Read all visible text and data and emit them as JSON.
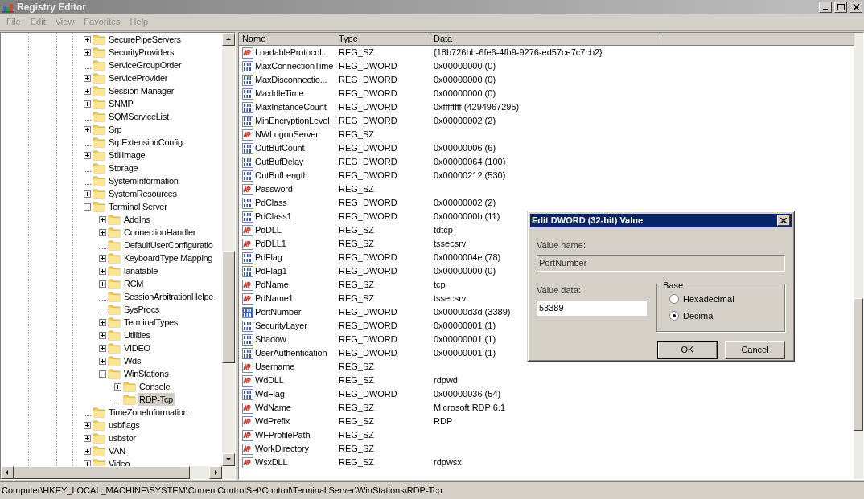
{
  "window": {
    "title": "Registry Editor"
  },
  "menu": [
    "File",
    "Edit",
    "View",
    "Favorites",
    "Help"
  ],
  "tree": [
    {
      "label": "SecurePipeServers",
      "kind": "collapsed",
      "selected": false
    },
    {
      "label": "SecurityProviders",
      "kind": "collapsed",
      "selected": false
    },
    {
      "label": "ServiceGroupOrder",
      "kind": "leaf",
      "selected": false
    },
    {
      "label": "ServiceProvider",
      "kind": "collapsed",
      "selected": false
    },
    {
      "label": "Session Manager",
      "kind": "collapsed",
      "selected": false
    },
    {
      "label": "SNMP",
      "kind": "collapsed",
      "selected": false
    },
    {
      "label": "SQMServiceList",
      "kind": "leaf",
      "selected": false
    },
    {
      "label": "Srp",
      "kind": "collapsed",
      "selected": false
    },
    {
      "label": "SrpExtensionConfig",
      "kind": "leaf",
      "selected": false
    },
    {
      "label": "StillImage",
      "kind": "collapsed",
      "selected": false
    },
    {
      "label": "Storage",
      "kind": "leaf",
      "selected": false
    },
    {
      "label": "SystemInformation",
      "kind": "leaf",
      "selected": false
    },
    {
      "label": "SystemResources",
      "kind": "collapsed",
      "selected": false
    },
    {
      "label": "Terminal Server",
      "kind": "expanded",
      "selected": false,
      "children": [
        {
          "label": "AddIns",
          "kind": "collapsed",
          "selected": false
        },
        {
          "label": "ConnectionHandler",
          "kind": "collapsed",
          "selected": false
        },
        {
          "label": "DefaultUserConfiguratio",
          "kind": "leaf",
          "selected": false
        },
        {
          "label": "KeyboardType Mapping",
          "kind": "collapsed",
          "selected": false
        },
        {
          "label": "lanatable",
          "kind": "collapsed",
          "selected": false
        },
        {
          "label": "RCM",
          "kind": "collapsed",
          "selected": false
        },
        {
          "label": "SessionArbitrationHelpe",
          "kind": "leaf",
          "selected": false
        },
        {
          "label": "SysProcs",
          "kind": "leaf",
          "selected": false
        },
        {
          "label": "TerminalTypes",
          "kind": "collapsed",
          "selected": false
        },
        {
          "label": "Utilities",
          "kind": "collapsed",
          "selected": false
        },
        {
          "label": "VIDEO",
          "kind": "collapsed",
          "selected": false
        },
        {
          "label": "Wds",
          "kind": "collapsed",
          "selected": false
        },
        {
          "label": "WinStations",
          "kind": "expanded",
          "selected": false,
          "children": [
            {
              "label": "Console",
              "kind": "collapsed",
              "selected": false
            },
            {
              "label": "RDP-Tcp",
              "kind": "leaf",
              "selected": true
            }
          ]
        }
      ]
    },
    {
      "label": "TimeZoneInformation",
      "kind": "leaf",
      "selected": false
    },
    {
      "label": "usbflags",
      "kind": "collapsed",
      "selected": false
    },
    {
      "label": "usbstor",
      "kind": "collapsed",
      "selected": false
    },
    {
      "label": "VAN",
      "kind": "collapsed",
      "selected": false
    },
    {
      "label": "Video",
      "kind": "collapsed",
      "selected": false
    }
  ],
  "table": {
    "columns": [
      "Name",
      "Type",
      "Data"
    ],
    "rows": [
      {
        "name": "LoadableProtocol...",
        "type": "REG_SZ",
        "data": "{18b726bb-6fe6-4fb9-9276-ed57ce7c7cb2}",
        "kind": "string",
        "selected": false
      },
      {
        "name": "MaxConnectionTime",
        "type": "REG_DWORD",
        "data": "0x00000000 (0)",
        "kind": "binary",
        "selected": false
      },
      {
        "name": "MaxDisconnectio...",
        "type": "REG_DWORD",
        "data": "0x00000000 (0)",
        "kind": "binary",
        "selected": false
      },
      {
        "name": "MaxIdleTime",
        "type": "REG_DWORD",
        "data": "0x00000000 (0)",
        "kind": "binary",
        "selected": false
      },
      {
        "name": "MaxInstanceCount",
        "type": "REG_DWORD",
        "data": "0xffffffff (4294967295)",
        "kind": "binary",
        "selected": false
      },
      {
        "name": "MinEncryptionLevel",
        "type": "REG_DWORD",
        "data": "0x00000002 (2)",
        "kind": "binary",
        "selected": false
      },
      {
        "name": "NWLogonServer",
        "type": "REG_SZ",
        "kind": "string",
        "selected": false
      },
      {
        "name": "OutBufCount",
        "type": "REG_DWORD",
        "data": "0x00000006 (6)",
        "kind": "binary",
        "selected": false
      },
      {
        "name": "OutBufDelay",
        "type": "REG_DWORD",
        "data": "0x00000064 (100)",
        "kind": "binary",
        "selected": false
      },
      {
        "name": "OutBufLength",
        "type": "REG_DWORD",
        "data": "0x00000212 (530)",
        "kind": "binary",
        "selected": false
      },
      {
        "name": "Password",
        "type": "REG_SZ",
        "kind": "string",
        "selected": false
      },
      {
        "name": "PdClass",
        "type": "REG_DWORD",
        "data": "0x00000002 (2)",
        "kind": "binary",
        "selected": false
      },
      {
        "name": "PdClass1",
        "type": "REG_DWORD",
        "data": "0x0000000b (11)",
        "kind": "binary",
        "selected": false
      },
      {
        "name": "PdDLL",
        "type": "REG_SZ",
        "data": "tdtcp",
        "kind": "string",
        "selected": false
      },
      {
        "name": "PdDLL1",
        "type": "REG_SZ",
        "data": "tssecsrv",
        "kind": "string",
        "selected": false
      },
      {
        "name": "PdFlag",
        "type": "REG_DWORD",
        "data": "0x0000004e (78)",
        "kind": "binary",
        "selected": false
      },
      {
        "name": "PdFlag1",
        "type": "REG_DWORD",
        "data": "0x00000000 (0)",
        "kind": "binary",
        "selected": false
      },
      {
        "name": "PdName",
        "type": "REG_SZ",
        "data": "tcp",
        "kind": "string",
        "selected": false
      },
      {
        "name": "PdName1",
        "type": "REG_SZ",
        "data": "tssecsrv",
        "kind": "string",
        "selected": false
      },
      {
        "name": "PortNumber",
        "type": "REG_DWORD",
        "data": "0x00000d3d (3389)",
        "kind": "binary",
        "selected": true
      },
      {
        "name": "SecurityLayer",
        "type": "REG_DWORD",
        "data": "0x00000001 (1)",
        "kind": "binary",
        "selected": false
      },
      {
        "name": "Shadow",
        "type": "REG_DWORD",
        "data": "0x00000001 (1)",
        "kind": "binary",
        "selected": false
      },
      {
        "name": "UserAuthentication",
        "type": "REG_DWORD",
        "data": "0x00000001 (1)",
        "kind": "binary",
        "selected": false
      },
      {
        "name": "Username",
        "type": "REG_SZ",
        "kind": "string",
        "selected": false
      },
      {
        "name": "WdDLL",
        "type": "REG_SZ",
        "data": "rdpwd",
        "kind": "string",
        "selected": false
      },
      {
        "name": "WdFlag",
        "type": "REG_DWORD",
        "data": "0x00000036 (54)",
        "kind": "binary",
        "selected": false
      },
      {
        "name": "WdName",
        "type": "REG_SZ",
        "data": "Microsoft RDP 6.1",
        "kind": "string",
        "selected": false
      },
      {
        "name": "WdPrefix",
        "type": "REG_SZ",
        "data": "RDP",
        "kind": "string",
        "selected": false
      },
      {
        "name": "WFProfilePath",
        "type": "REG_SZ",
        "kind": "string",
        "selected": false
      },
      {
        "name": "WorkDirectory",
        "type": "REG_SZ",
        "kind": "string",
        "selected": false
      },
      {
        "name": "WsxDLL",
        "type": "REG_SZ",
        "data": "rdpwsx",
        "kind": "string",
        "selected": false
      }
    ]
  },
  "dialog": {
    "title": "Edit DWORD (32-bit) Value",
    "value_name_label": "Value name:",
    "value_name": "PortNumber",
    "value_data_label": "Value data:",
    "value_data": "53389",
    "base_label": "Base",
    "base_options": [
      {
        "label": "Hexadecimal",
        "selected": false
      },
      {
        "label": "Decimal",
        "selected": true
      }
    ],
    "buttons": [
      "OK",
      "Cancel"
    ]
  },
  "status_bar": "Computer\\HKEY_LOCAL_MACHINE\\SYSTEM\\CurrentControlSet\\Control\\Terminal Server\\WinStations\\RDP-Tcp"
}
